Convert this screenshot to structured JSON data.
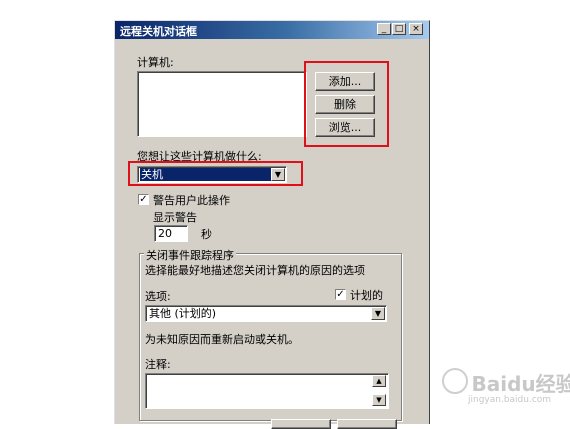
{
  "window": {
    "title": "远程关机对话框",
    "controls": {
      "minimize": "_",
      "maximize": "□",
      "close": "×"
    }
  },
  "computers": {
    "label": "计算机:",
    "items": []
  },
  "buttons": {
    "add": "添加...",
    "delete": "删除",
    "browse": "浏览..."
  },
  "action": {
    "label": "您想让这些计算机做什么:",
    "selected": "关机"
  },
  "warn": {
    "checkbox_label": "警告用户此操作",
    "checked": true,
    "display_label": "显示警告",
    "seconds_value": "20",
    "seconds_unit": "秒"
  },
  "tracker": {
    "group_label": "关闭事件跟踪程序",
    "description": "选择能最好地描述您关闭计算机的原因的选项",
    "option_label": "选项:",
    "planned_label": "计划的",
    "planned_checked": true,
    "reason_selected": "其他 (计划的)",
    "reason_description": "为未知原因而重新启动或关机。",
    "comment_label": "注释:",
    "comment_value": ""
  },
  "watermark": {
    "text": "Baidu经验",
    "subtext": "jingyan.baidu.com"
  }
}
